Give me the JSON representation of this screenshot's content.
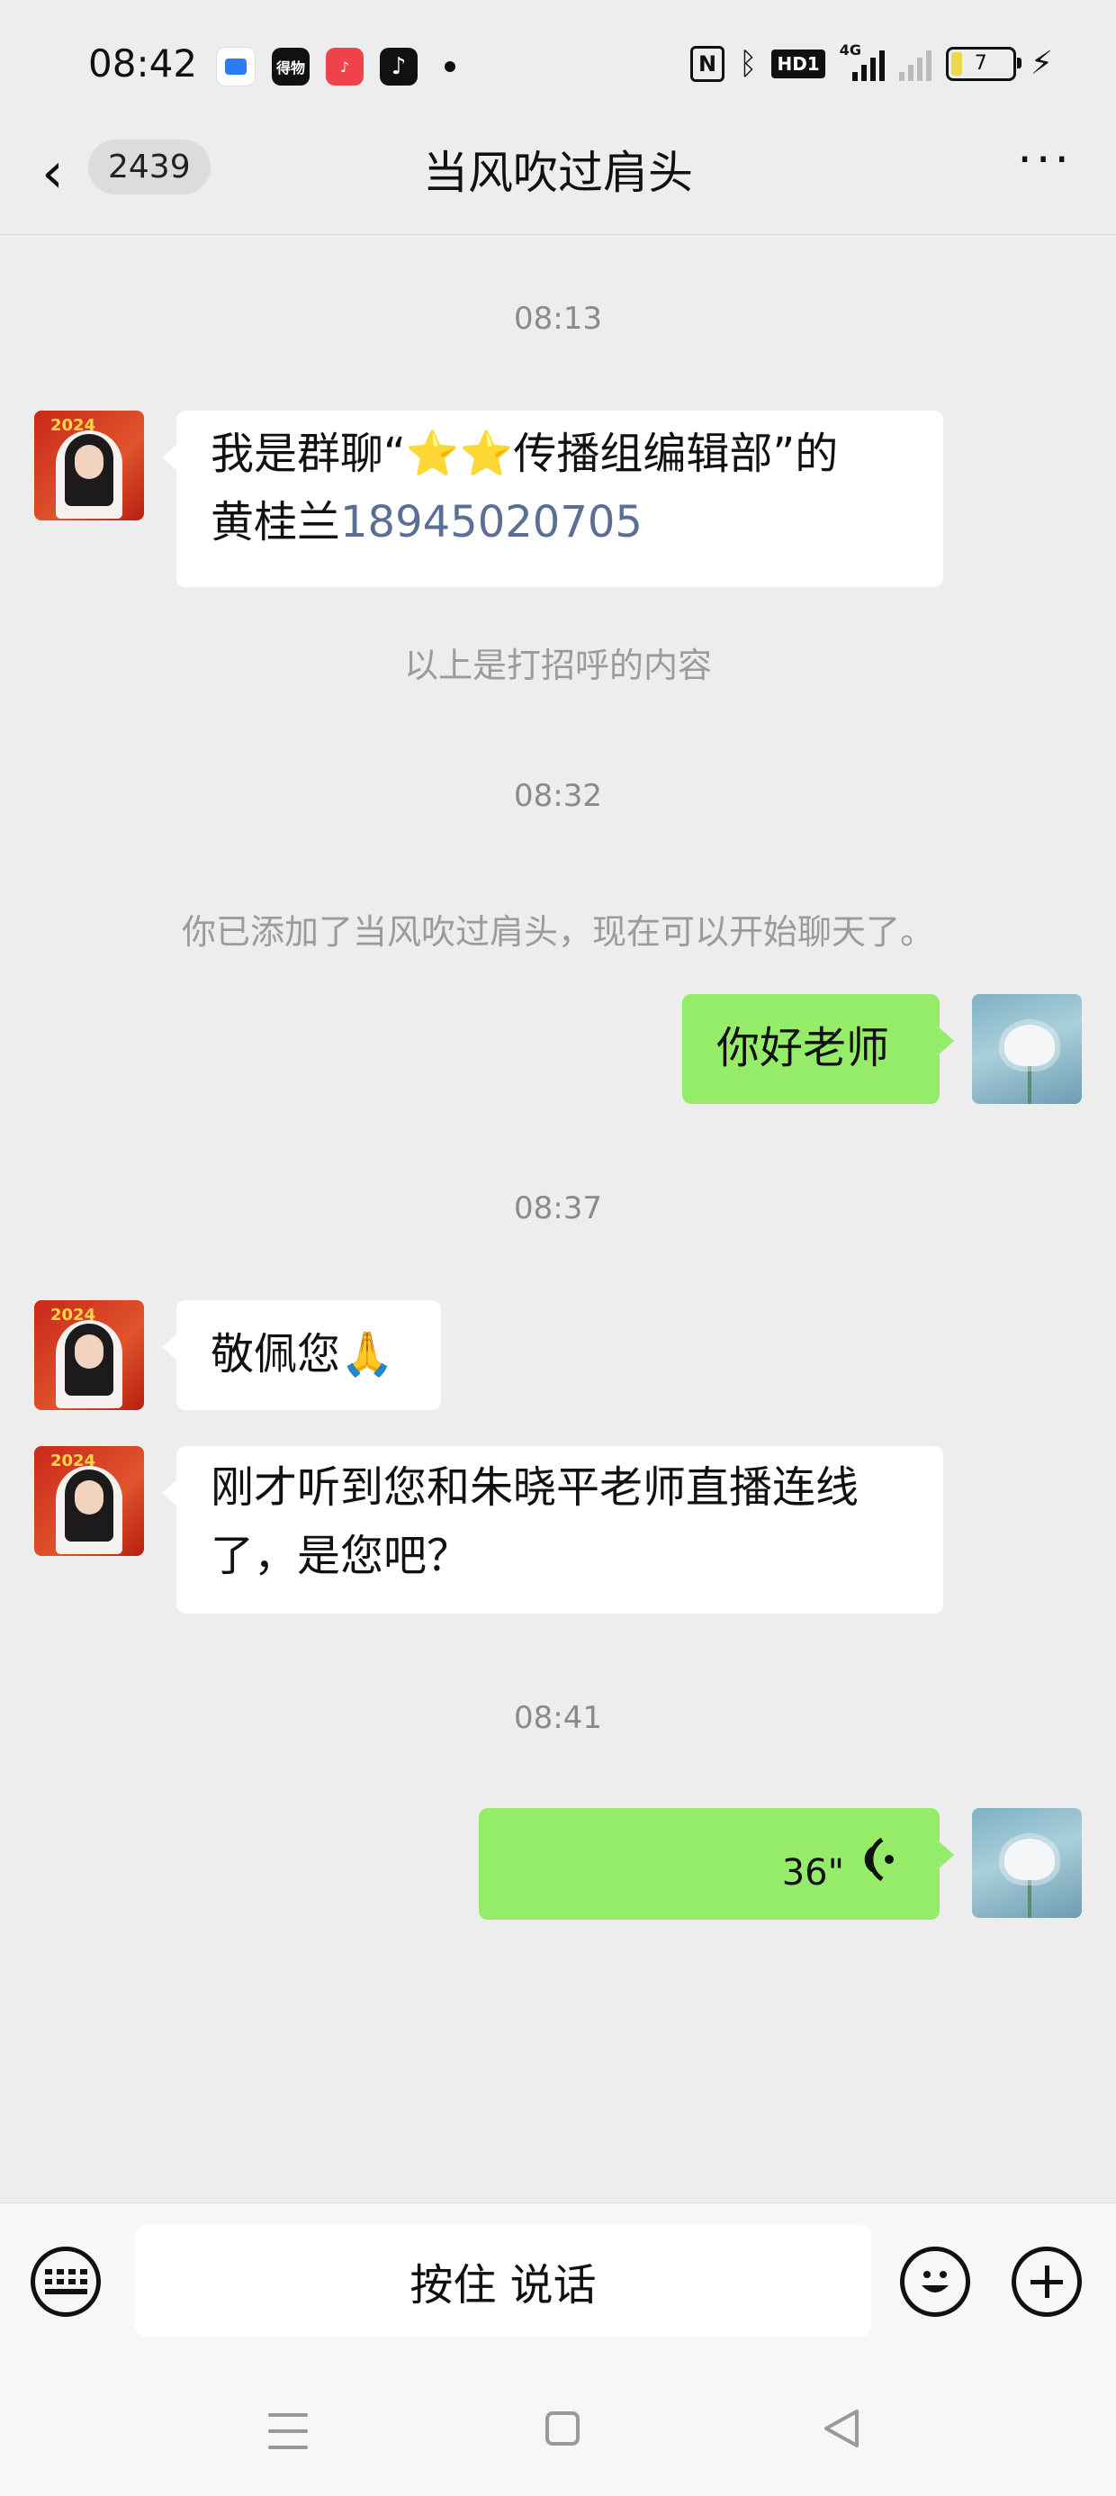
{
  "status_bar": {
    "time": "08:42",
    "app_icons": [
      "blue-app-icon",
      "dewu-app-icon",
      "music-app-icon",
      "tiktok-app-icon"
    ],
    "hd_label": "HD1",
    "network_label": "4G",
    "battery_level": "7"
  },
  "header": {
    "unread_count": "2439",
    "title": "当风吹过肩头",
    "more_label": "···"
  },
  "messages": [
    {
      "type": "timestamp",
      "text": "08:13"
    },
    {
      "type": "incoming",
      "text_before": "我是群聊“⭐⭐传播组编辑部”的",
      "text_line2": "黄桂兰",
      "phone": "18945020705"
    },
    {
      "type": "system",
      "text": "以上是打招呼的内容"
    },
    {
      "type": "timestamp",
      "text": "08:32"
    },
    {
      "type": "system",
      "text": "你已添加了当风吹过肩头，现在可以开始聊天了。"
    },
    {
      "type": "outgoing",
      "text": "你好老师"
    },
    {
      "type": "timestamp",
      "text": "08:37"
    },
    {
      "type": "incoming",
      "text": "敬佩您🙏"
    },
    {
      "type": "incoming",
      "text_line1": "刚才听到您和朱晓平老师直播连线",
      "text_line2": "了，是您吧？"
    },
    {
      "type": "timestamp",
      "text": "08:41"
    },
    {
      "type": "outgoing-voice",
      "duration": "36\""
    }
  ],
  "avatar_left": {
    "year_text": "2024"
  },
  "input_bar": {
    "hold_to_talk": "按住 说话"
  },
  "colors": {
    "background": "#ededed",
    "outgoing_bubble": "#95ec69",
    "incoming_bubble": "#ffffff",
    "link": "#5a6f93"
  }
}
